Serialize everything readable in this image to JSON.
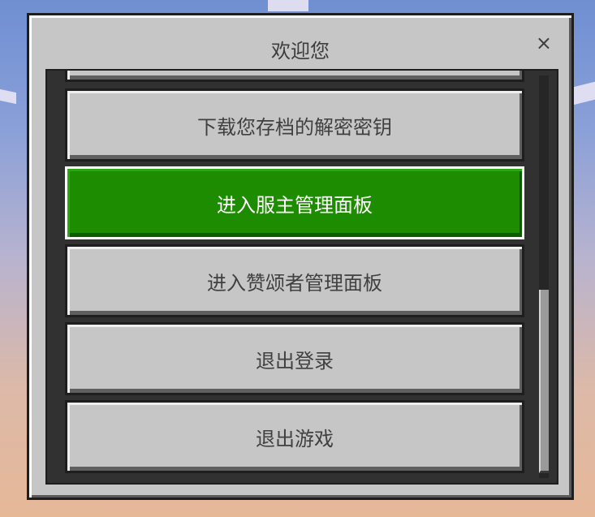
{
  "dialog": {
    "title": "欢迎您",
    "close_label": "×"
  },
  "menu": {
    "items": [
      {
        "label": ""
      },
      {
        "label": "下载您存档的解密密钥"
      },
      {
        "label": "进入服主管理面板",
        "selected": true
      },
      {
        "label": "进入赞颂者管理面板"
      },
      {
        "label": "退出登录"
      },
      {
        "label": "退出游戏"
      }
    ]
  },
  "colors": {
    "panel": "#c6c6c6",
    "selected_button": "#1e8c00",
    "list_background": "#313131",
    "text": "#404040"
  },
  "scrollbar": {
    "position_fraction": 0.55
  }
}
